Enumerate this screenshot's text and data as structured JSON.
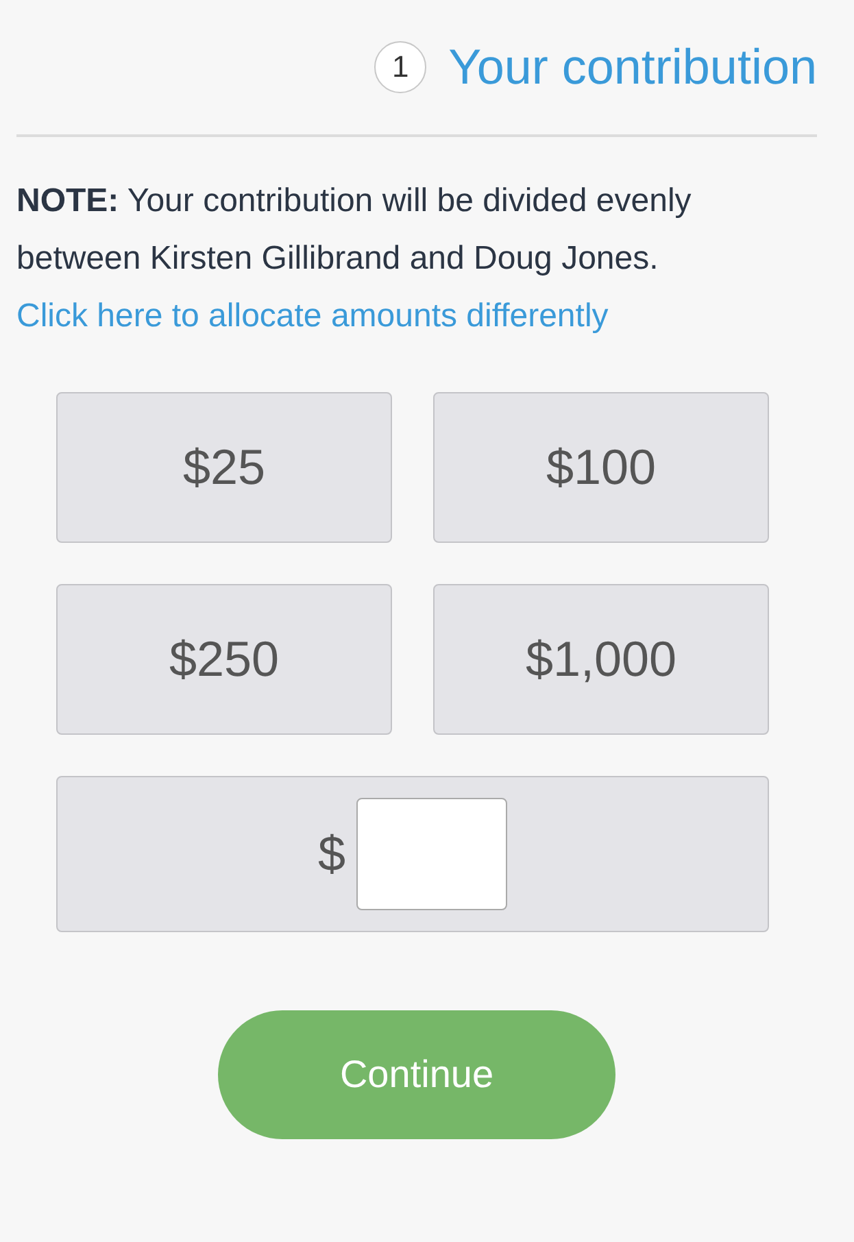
{
  "header": {
    "step": "1",
    "title": "Your contribution"
  },
  "note": {
    "text": "**NOTE:** Your contribution will be divided evenly between Kirsten Gillibrand and Doug Jones.",
    "link": "Click here to allocate amounts differently"
  },
  "amounts": [
    "$25",
    "$100",
    "$250",
    "$1,000"
  ],
  "custom_amount": {
    "prefix": "$"
  },
  "continue_button": "Continue"
}
